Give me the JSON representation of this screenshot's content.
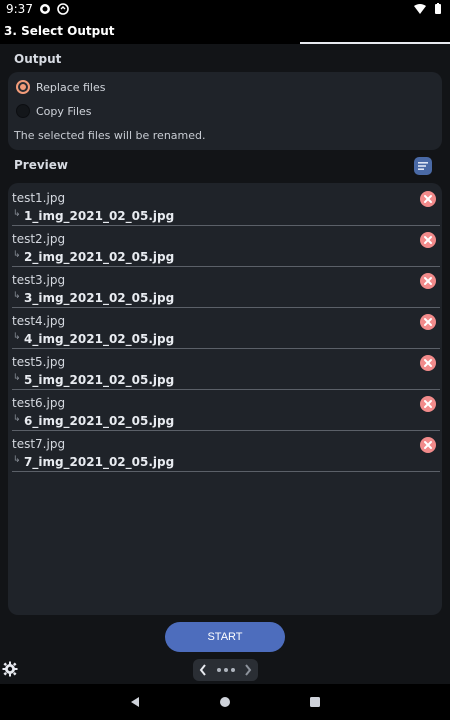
{
  "status_bar": {
    "time": "9:37"
  },
  "app_bar": {
    "title": "3. Select Output"
  },
  "output": {
    "section_title": "Output",
    "options": [
      {
        "label": "Replace files",
        "selected": true
      },
      {
        "label": "Copy Files",
        "selected": false
      }
    ],
    "hint": "The selected files will be renamed."
  },
  "preview": {
    "section_title": "Preview",
    "items": [
      {
        "original": "test1.jpg",
        "renamed": "1_img_2021_02_05.jpg"
      },
      {
        "original": "test2.jpg",
        "renamed": "2_img_2021_02_05.jpg"
      },
      {
        "original": "test3.jpg",
        "renamed": "3_img_2021_02_05.jpg"
      },
      {
        "original": "test4.jpg",
        "renamed": "4_img_2021_02_05.jpg"
      },
      {
        "original": "test5.jpg",
        "renamed": "5_img_2021_02_05.jpg"
      },
      {
        "original": "test6.jpg",
        "renamed": "6_img_2021_02_05.jpg"
      },
      {
        "original": "test7.jpg",
        "renamed": "7_img_2021_02_05.jpg"
      }
    ]
  },
  "actions": {
    "start_label": "START"
  },
  "colors": {
    "accent_radio": "#f39c7a",
    "primary_button": "#4d6dbd",
    "delete": "#f28b8b"
  },
  "icons": [
    "settings-icon",
    "chevron-left-icon",
    "chevron-right-icon",
    "delete-icon",
    "list-icon"
  ]
}
